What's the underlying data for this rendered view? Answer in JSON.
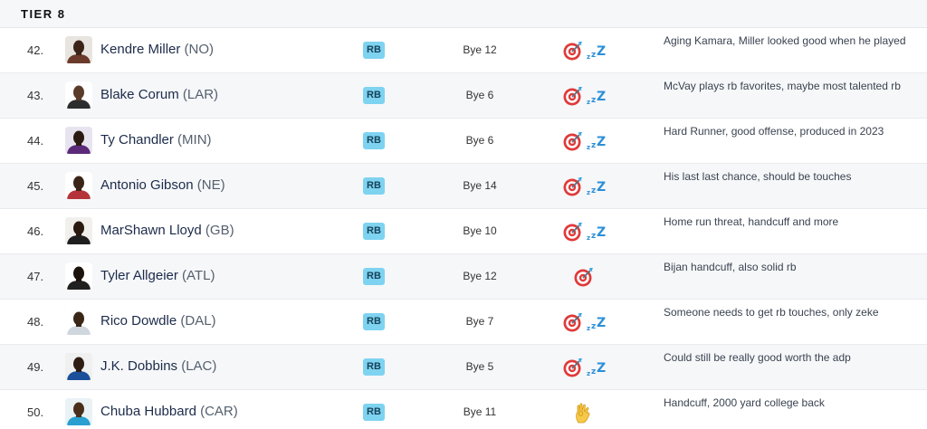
{
  "tier": {
    "label": "TIER 8"
  },
  "colors": {
    "badge_bg": "#7ed3f0",
    "badge_text": "#16435a",
    "alt_row": "#f6f7f9"
  },
  "rows": [
    {
      "rank": "42.",
      "name": "Kendre Miller",
      "team": "(NO)",
      "pos": "RB",
      "bye": "Bye 12",
      "icons": [
        "target-icon",
        "zzz-icon"
      ],
      "note": "Aging Kamara, Miller looked good when he played"
    },
    {
      "rank": "43.",
      "name": "Blake Corum",
      "team": "(LAR)",
      "pos": "RB",
      "bye": "Bye 6",
      "icons": [
        "target-icon",
        "zzz-icon"
      ],
      "note": "McVay plays rb favorites, maybe most talented rb"
    },
    {
      "rank": "44.",
      "name": "Ty Chandler",
      "team": "(MIN)",
      "pos": "RB",
      "bye": "Bye 6",
      "icons": [
        "target-icon",
        "zzz-icon"
      ],
      "note": "Hard Runner, good offense, produced in 2023"
    },
    {
      "rank": "45.",
      "name": "Antonio Gibson",
      "team": "(NE)",
      "pos": "RB",
      "bye": "Bye 14",
      "icons": [
        "target-icon",
        "zzz-icon"
      ],
      "note": "His last last chance, should be touches"
    },
    {
      "rank": "46.",
      "name": "MarShawn Lloyd",
      "team": "(GB)",
      "pos": "RB",
      "bye": "Bye 10",
      "icons": [
        "target-icon",
        "zzz-icon"
      ],
      "note": "Home run threat, handcuff and more"
    },
    {
      "rank": "47.",
      "name": "Tyler Allgeier",
      "team": "(ATL)",
      "pos": "RB",
      "bye": "Bye 12",
      "icons": [
        "target-icon"
      ],
      "note": "Bijan handcuff, also solid rb"
    },
    {
      "rank": "48.",
      "name": "Rico Dowdle",
      "team": "(DAL)",
      "pos": "RB",
      "bye": "Bye 7",
      "icons": [
        "target-icon",
        "zzz-icon"
      ],
      "note": "Someone needs to get rb touches, only zeke"
    },
    {
      "rank": "49.",
      "name": "J.K. Dobbins",
      "team": "(LAC)",
      "pos": "RB",
      "bye": "Bye 5",
      "icons": [
        "target-icon",
        "zzz-icon"
      ],
      "note": "Could still be really good worth the adp"
    },
    {
      "rank": "50.",
      "name": "Chuba Hubbard",
      "team": "(CAR)",
      "pos": "RB",
      "bye": "Bye 11",
      "icons": [
        "ok-hand-icon"
      ],
      "note": "Handcuff, 2000 yard college back"
    }
  ]
}
